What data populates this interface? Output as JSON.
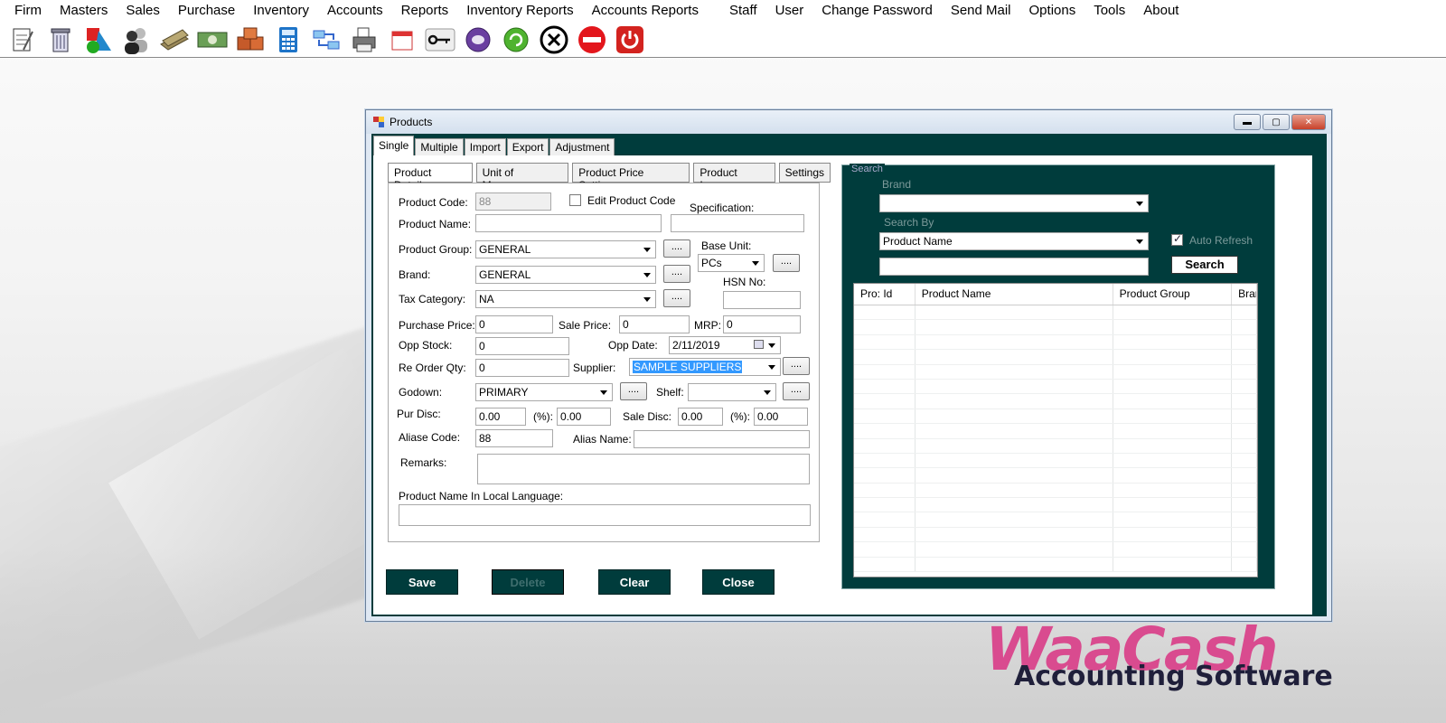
{
  "menu": [
    "Firm",
    "Masters",
    "Sales",
    "Purchase",
    "Inventory",
    "Accounts",
    "Reports",
    "Inventory Reports",
    "Accounts Reports",
    "Staff",
    "User",
    "Change Password",
    "Send Mail",
    "Options",
    "Tools",
    "About"
  ],
  "toolbar_icons": [
    "notepad-icon",
    "recycle-bin-icon",
    "shapes-icon",
    "users-icon",
    "money-icon",
    "cash-note-icon",
    "boxes-icon",
    "calculator-icon",
    "transfer-icon",
    "printer-icon",
    "calendar-icon",
    "key-icon",
    "alien-icon",
    "refresh-icon",
    "cancel-icon",
    "no-entry-icon",
    "power-icon"
  ],
  "window": {
    "title": "Products",
    "tabs": [
      "Single",
      "Multiple",
      "Import",
      "Export",
      "Adjustment"
    ],
    "inner_tabs": [
      "Product Details",
      "Unit of Meassure",
      "Product Price Settings",
      "Product Image",
      "Settings"
    ]
  },
  "form": {
    "product_code_label": "Product Code:",
    "product_code": "88",
    "edit_product_code_label": "Edit Product Code",
    "specification_label": "Specification:",
    "product_name_label": "Product Name:",
    "product_group_label": "Product Group:",
    "product_group": "GENERAL",
    "base_unit_label": "Base Unit:",
    "base_unit": "PCs",
    "brand_label": "Brand:",
    "brand": "GENERAL",
    "hsn_label": "HSN No:",
    "tax_category_label": "Tax Category:",
    "tax_category": "NA",
    "purchase_price_label": "Purchase Price:",
    "purchase_price": "0",
    "sale_price_label": "Sale Price:",
    "sale_price": "0",
    "mrp_label": "MRP:",
    "mrp": "0",
    "opp_stock_label": "Opp Stock:",
    "opp_stock": "0",
    "opp_date_label": "Opp Date:",
    "opp_date": "2/11/2019",
    "reorder_label": "Re Order Qty:",
    "reorder": "0",
    "supplier_label": "Supplier:",
    "supplier": "SAMPLE SUPPLIERS",
    "godown_label": "Godown:",
    "godown": "PRIMARY",
    "shelf_label": "Shelf:",
    "pur_disc_label": "Pur Disc:",
    "pur_disc": "0.00",
    "pct_label": "(%):",
    "pur_disc_pct": "0.00",
    "sale_disc_label": "Sale Disc:",
    "sale_disc": "0.00",
    "sale_disc_pct": "0.00",
    "aliase_code_label": "Aliase Code:",
    "aliase_code": "88",
    "alias_name_label": "Alias Name:",
    "remarks_label": "Remarks:",
    "local_name_label": "Product Name In Local Language:",
    "dots": "...."
  },
  "actions": {
    "save": "Save",
    "delete": "Delete",
    "clear": "Clear",
    "close": "Close"
  },
  "search": {
    "legend": "Search",
    "brand_label": "Brand",
    "search_by_label": "Search By",
    "search_by": "Product Name",
    "auto_refresh": "Auto Refresh",
    "search_button": "Search",
    "columns": [
      "Pro: Id",
      "Product Name",
      "Product Group",
      "Bran"
    ]
  },
  "logo": {
    "main": "WaaCash",
    "sub": "Accounting Software",
    "fragment": "e"
  },
  "colors": {
    "dark_teal": "#003c3c",
    "logo_pink": "#d94b8f"
  }
}
